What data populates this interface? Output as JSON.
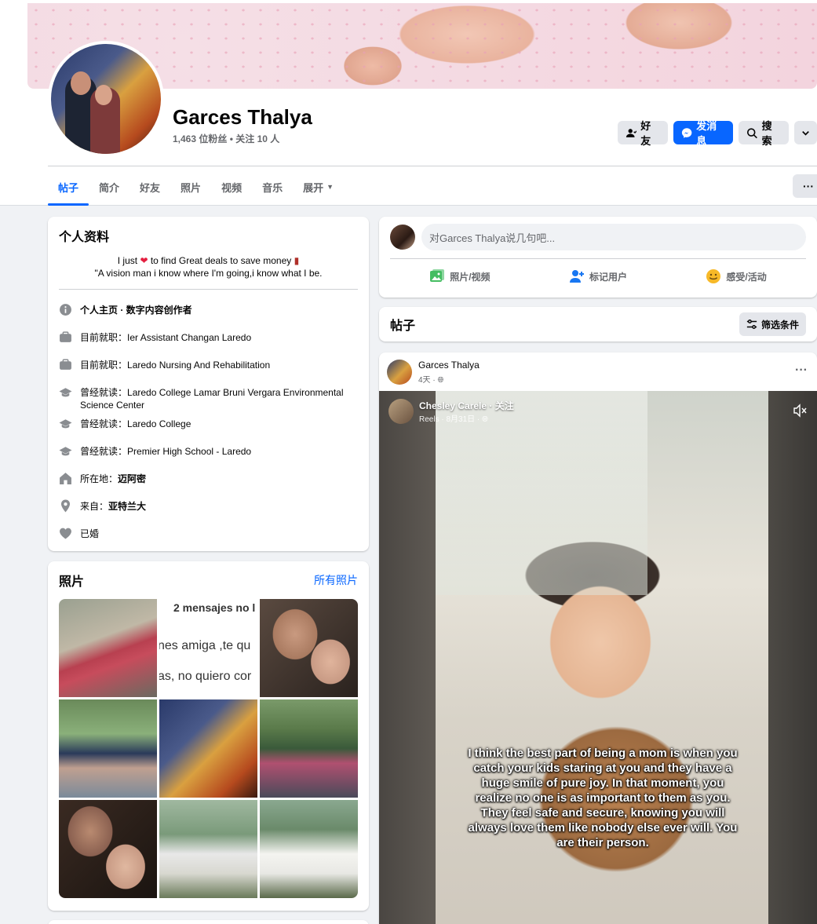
{
  "profile": {
    "name": "Garces Thalya",
    "followers_text": "1,463 位粉丝 • 关注 10 人"
  },
  "actions": {
    "friends": "好友",
    "message": "发消息",
    "search": "搜索"
  },
  "tabs": [
    {
      "label": "帖子"
    },
    {
      "label": "简介"
    },
    {
      "label": "好友"
    },
    {
      "label": "照片"
    },
    {
      "label": "视频"
    },
    {
      "label": "音乐"
    },
    {
      "label": "展开"
    }
  ],
  "more_label": "···",
  "intro": {
    "title": "个人资料",
    "bio_line1_a": "I just",
    "bio_line1_b": "to find Great deals to save money",
    "bio_line2": "\"A vision man i know where I'm going,i know what I be.",
    "items": [
      {
        "prefix": "个人主页 · 数字内容创作者",
        "value": "",
        "icon": "info-icon"
      },
      {
        "prefix": "目前就职：",
        "value": "Ier Assistant Changan Laredo",
        "icon": "briefcase-icon"
      },
      {
        "prefix": "目前就职：",
        "value": "Laredo Nursing And Rehabilitation",
        "icon": "briefcase-icon"
      },
      {
        "prefix": "曾经就读：",
        "value": "Laredo College Lamar Bruni Vergara Environmental Science Center",
        "icon": "graduation-cap-icon"
      },
      {
        "prefix": "曾经就读：",
        "value": "Laredo College",
        "icon": "graduation-cap-icon"
      },
      {
        "prefix": "曾经就读：",
        "value": "Premier High School - Laredo",
        "icon": "graduation-cap-icon"
      },
      {
        "prefix": "所在地：",
        "value": "迈阿密",
        "icon": "home-icon"
      },
      {
        "prefix": "来自：",
        "value": "亚特兰大",
        "icon": "location-pin-icon"
      },
      {
        "prefix": "已婚",
        "value": "",
        "icon": "heart-icon"
      }
    ]
  },
  "photos": {
    "title": "照片",
    "all_link": "所有照片",
    "text_photo_lines": [
      "2 mensajes no l",
      "nes amiga ,te qu",
      "as, no quiero cor"
    ]
  },
  "composer": {
    "placeholder": "对Garces Thalya说几句吧...",
    "photo_video": "照片/视频",
    "tag_people": "标记用户",
    "feeling": "感受/活动"
  },
  "posts_header": {
    "title": "帖子",
    "filter": "筛选条件"
  },
  "post": {
    "author": "Garces Thalya",
    "time": "4天 · ",
    "reel_author": "Chesley Carele · 关注",
    "reel_meta": "Reels · 8月31日 · ",
    "caption": "I think the best part of being a mom is when you catch your kids staring at you and they have a huge smile of pure joy. In that moment, you realize no one is as important to them as you. They feel safe and secure, knowing you will always love them like nobody else ever will. You are their person."
  },
  "colors": {
    "accent": "#0866ff",
    "background": "#f0f2f5",
    "secondary_text": "#65676b"
  }
}
